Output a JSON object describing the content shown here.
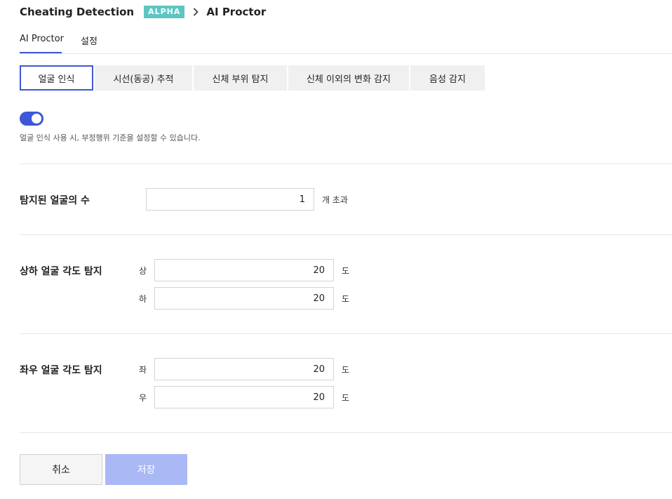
{
  "header": {
    "app_title": "Cheating Detection",
    "badge": "ALPHA",
    "current_page": "AI Proctor"
  },
  "top_tabs": [
    {
      "label": "AI Proctor",
      "active": true
    },
    {
      "label": "설정",
      "active": false
    }
  ],
  "sub_tabs": [
    {
      "label": "얼굴 인식",
      "active": true
    },
    {
      "label": "시선(동공) 추적",
      "active": false
    },
    {
      "label": "신체 부위 탐지",
      "active": false
    },
    {
      "label": "신체 이외의 변화 감지",
      "active": false
    },
    {
      "label": "음성 감지",
      "active": false
    }
  ],
  "face_recognition": {
    "enabled": true,
    "description": "얼굴 인식 사용 시, 부정행위 기준을 설정할 수 있습니다.",
    "face_count": {
      "label": "탐지된 얼굴의 수",
      "value": "1",
      "unit": "개 초과"
    },
    "vertical_angle": {
      "label": "상하 얼굴 각도 탐지",
      "up_label": "상",
      "up_value": "20",
      "down_label": "하",
      "down_value": "20",
      "unit": "도"
    },
    "horizontal_angle": {
      "label": "좌우 얼굴 각도 탐지",
      "left_label": "좌",
      "left_value": "20",
      "right_label": "우",
      "right_value": "20",
      "unit": "도"
    }
  },
  "actions": {
    "cancel_label": "취소",
    "save_label": "저장"
  },
  "colors": {
    "accent": "#3d57d8",
    "badge": "#5dc6c2",
    "save_disabled": "#aab8f5"
  }
}
